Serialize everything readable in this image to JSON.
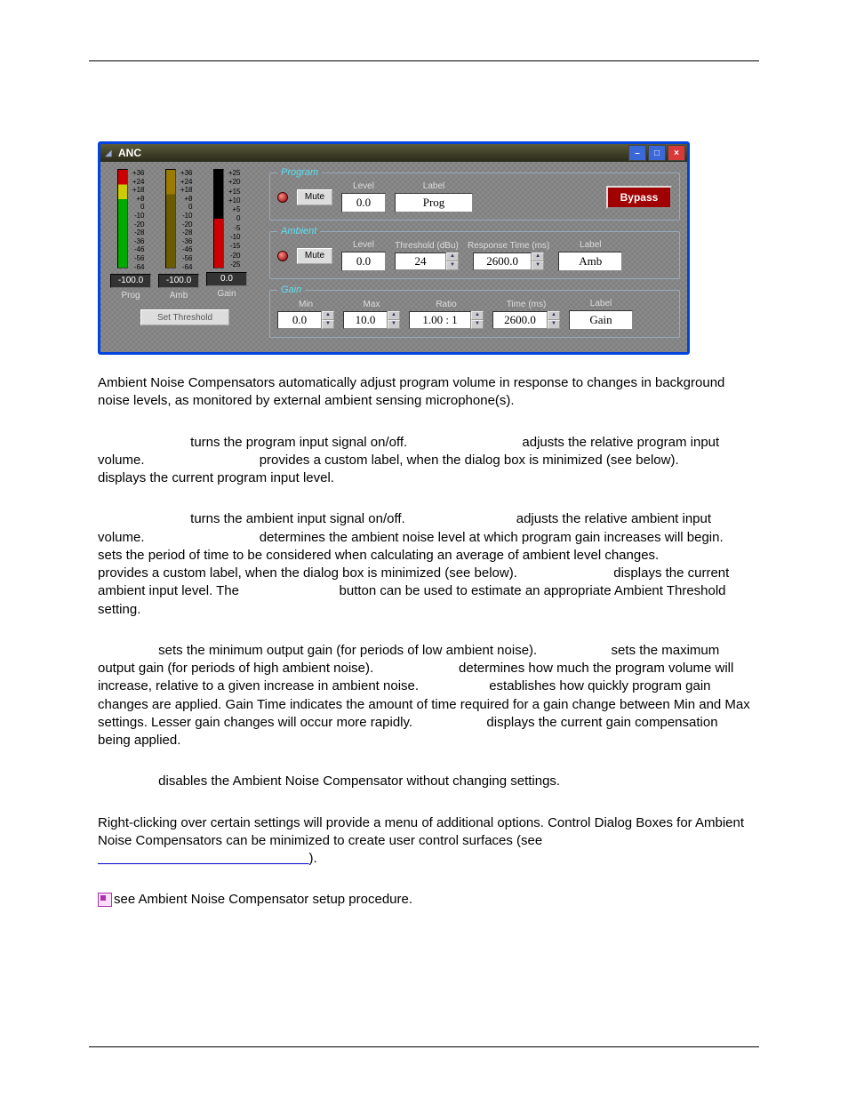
{
  "window": {
    "title": "ANC",
    "buttons": {
      "min": "–",
      "max": "□",
      "close": "×"
    }
  },
  "meters": {
    "scale_main": [
      "+36",
      "+24",
      "+18",
      "+8",
      "0",
      "-10",
      "-20",
      "-28",
      "-36",
      "-46",
      "-56",
      "-64"
    ],
    "scale_gain": [
      "+25",
      "+20",
      "+15",
      "+10",
      "+5",
      "0",
      "-5",
      "-10",
      "-15",
      "-20",
      "-25"
    ],
    "readouts": {
      "prog": "-100.0",
      "amb": "-100.0",
      "gain": "0.0"
    },
    "labels": {
      "prog": "Prog",
      "amb": "Amb",
      "gain": "Gain"
    },
    "set_threshold": "Set Threshold"
  },
  "program": {
    "legend": "Program",
    "mute": "Mute",
    "level_label": "Level",
    "level": "0.0",
    "label_label": "Label",
    "label": "Prog"
  },
  "ambient": {
    "legend": "Ambient",
    "mute": "Mute",
    "level_label": "Level",
    "level": "0.0",
    "threshold_label": "Threshold (dBu)",
    "threshold": "24",
    "response_label": "Response Time (ms)",
    "response": "2600.0",
    "label_label": "Label",
    "label": "Amb"
  },
  "gain": {
    "legend": "Gain",
    "min_label": "Min",
    "min": "0.0",
    "max_label": "Max",
    "max": "10.0",
    "ratio_label": "Ratio",
    "ratio": "1.00 : 1",
    "time_label": "Time (ms)",
    "time": "2600.0",
    "label_label": "Label",
    "label": "Gain"
  },
  "bypass": "Bypass",
  "text": {
    "intro": "Ambient Noise Compensators automatically adjust program volume in response to changes in background noise levels, as monitored by external ambient sensing microphone(s).",
    "program": " turns the program input signal on/off.                               adjusts the relative program input volume.                               provides a custom label, when the dialog box is minimized (see below).                          displays the current program input level.",
    "ambient": " turns the ambient input signal on/off.                              adjusts the relative ambient input volume.                               determines the ambient noise level at which program gain increases will begin.                                    sets the period of time to be considered when calculating an average of ambient level changes.                               provides a custom label, when the dialog box is minimized (see below).                          displays the current ambient input level. The                           button can be used to estimate an appropriate Ambient Threshold setting.",
    "gainp": " sets the minimum output gain (for periods of low ambient noise).                    sets the maximum output gain (for periods of high ambient noise).                       determines how much the program volume will increase, relative to a given increase in ambient noise.                   establishes how quickly program gain changes are applied. Gain Time indicates the amount of time required for a gain change between Min and Max settings. Lesser gain changes will occur more rapidly.                    displays the current gain compensation being applied.",
    "bypassp": " disables the Ambient Noise Compensator without changing settings.",
    "rclick1": "Right-clicking over certain settings will provide a menu of additional options. Control Dialog Boxes for Ambient Noise Compensators can be minimized to create user control surfaces (see ",
    "rclick_link": "                                                         ",
    "rclick2": ").",
    "note": "see Ambient Noise Compensator setup procedure."
  }
}
